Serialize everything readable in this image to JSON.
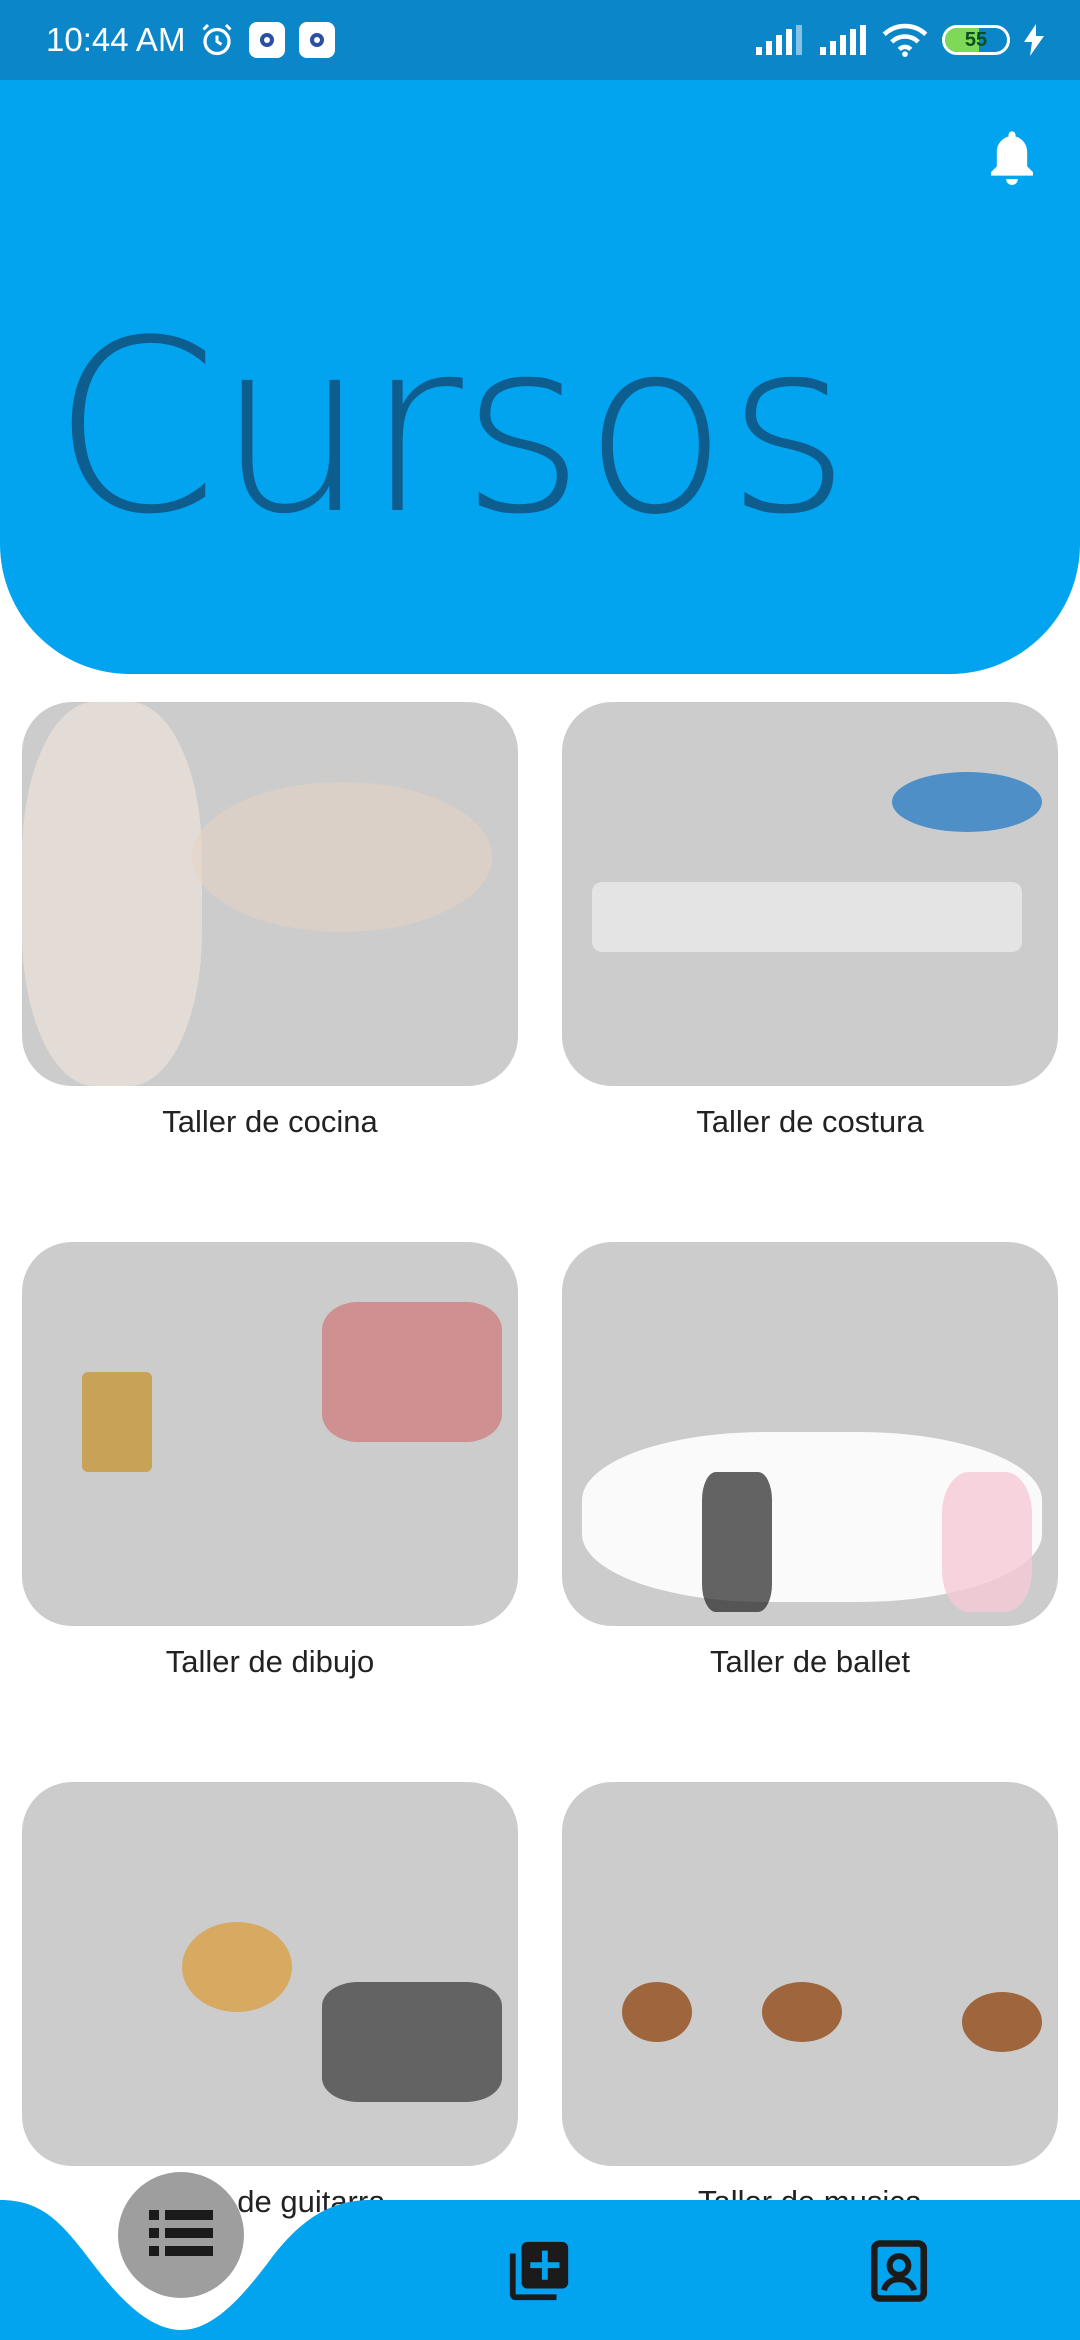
{
  "status_bar": {
    "time": "10:44 AM",
    "battery": "55"
  },
  "header": {
    "title": "Cursos",
    "bell_icon": "notification-bell-icon"
  },
  "courses": [
    {
      "label": "Taller de cocina"
    },
    {
      "label": "Taller de costura"
    },
    {
      "label": "Taller de dibujo"
    },
    {
      "label": "Taller de ballet"
    },
    {
      "label": "Taller de guitarra"
    },
    {
      "label": "Taller de musica"
    }
  ],
  "bottom_nav": {
    "items": [
      {
        "icon": "list-icon"
      },
      {
        "icon": "add-box-icon"
      },
      {
        "icon": "contact-profile-icon"
      }
    ]
  },
  "colors": {
    "accent": "#03a4ef",
    "status_bar": "#0b87c9",
    "title": "#0d5d8f",
    "fab": "#9e9e9e"
  }
}
